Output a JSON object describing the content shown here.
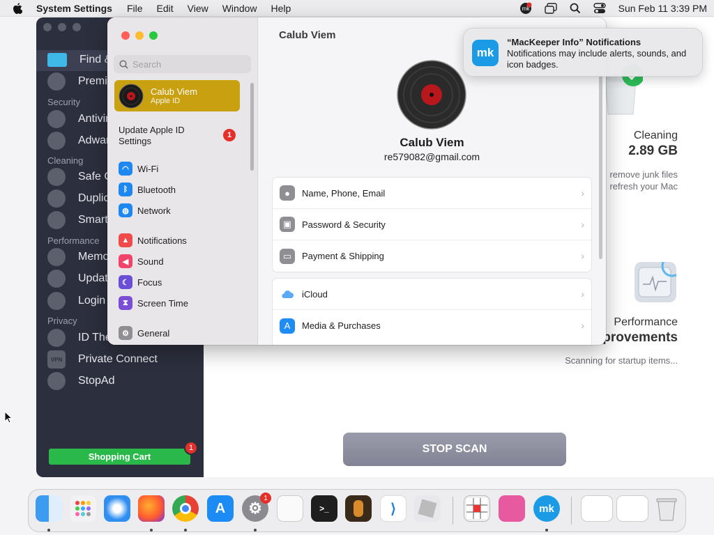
{
  "menubar": {
    "app_name": "System Settings",
    "menus": [
      "File",
      "Edit",
      "View",
      "Window",
      "Help"
    ],
    "clock": "Sun Feb 11  3:39 PM"
  },
  "mackeeper": {
    "sidebar": [
      {
        "label": "Find & Fix",
        "icon": "monitor-icon"
      },
      {
        "label": "Premium Services",
        "icon": "headset-icon"
      },
      {
        "section": "Security"
      },
      {
        "label": "Antivirus",
        "icon": "virus-icon"
      },
      {
        "label": "Adware Cleaner",
        "icon": "hand-icon"
      },
      {
        "section": "Cleaning"
      },
      {
        "label": "Safe Cleanup",
        "icon": "cleanup-icon"
      },
      {
        "label": "Duplicates Finder",
        "icon": "duplicates-icon"
      },
      {
        "label": "Smart Uninstaller",
        "icon": "uninstaller-icon"
      },
      {
        "section": "Performance"
      },
      {
        "label": "Memory Cleaner",
        "icon": "memory-icon"
      },
      {
        "label": "Update Tracker",
        "icon": "update-icon"
      },
      {
        "label": "Login Items",
        "icon": "rocket-icon"
      },
      {
        "section": "Privacy"
      },
      {
        "label": "ID Theft Guard",
        "icon": "fingerprint-icon"
      },
      {
        "label": "Private Connect",
        "icon": "vpn-icon"
      },
      {
        "label": "StopAd",
        "icon": "stopad-icon"
      }
    ],
    "cart_label": "Shopping Cart",
    "cart_badge": "1",
    "cleaning_title": "Cleaning",
    "cleaning_size": "2.89 GB",
    "cleaning_desc1": "remove junk files",
    "cleaning_desc2": "refresh your Mac",
    "perf_title": "Performance",
    "perf_sub": "provements",
    "perf_desc": "Scanning for startup items...",
    "stop_scan": "STOP SCAN"
  },
  "settings": {
    "search_placeholder": "Search",
    "user_name": "Calub Viem",
    "user_sub": "Apple ID",
    "update_label": "Update Apple ID Settings",
    "update_badge": "1",
    "sidebar": [
      {
        "label": "Wi-Fi",
        "color": "#1e88f0"
      },
      {
        "label": "Bluetooth",
        "color": "#1e88f0"
      },
      {
        "label": "Network",
        "color": "#1e88f0"
      },
      {
        "label": "Notifications",
        "color": "#f04a4a"
      },
      {
        "label": "Sound",
        "color": "#f0446a"
      },
      {
        "label": "Focus",
        "color": "#6a4fd6"
      },
      {
        "label": "Screen Time",
        "color": "#7a4fd6"
      },
      {
        "label": "General",
        "color": "#8e8e93"
      }
    ],
    "header": "Calub Viem",
    "name": "Calub Viem",
    "email": "re579082@gmail.com",
    "group1": [
      {
        "label": "Name, Phone, Email",
        "icon": "person-icon",
        "color": "#8e8e93"
      },
      {
        "label": "Password & Security",
        "icon": "lock-icon",
        "color": "#8e8e93"
      },
      {
        "label": "Payment & Shipping",
        "icon": "card-icon",
        "color": "#8e8e93"
      }
    ],
    "group2": [
      {
        "label": "iCloud",
        "icon": "cloud-icon",
        "color": "#ffffff"
      },
      {
        "label": "Media & Purchases",
        "icon": "appstore-icon",
        "color": "#1f8cf5"
      }
    ]
  },
  "notification": {
    "title": "“MacKeeper Info” Notifications",
    "body": "Notifications may include alerts, sounds, and icon badges.",
    "logo": "mk"
  },
  "dock": {
    "sys_badge": "1"
  }
}
